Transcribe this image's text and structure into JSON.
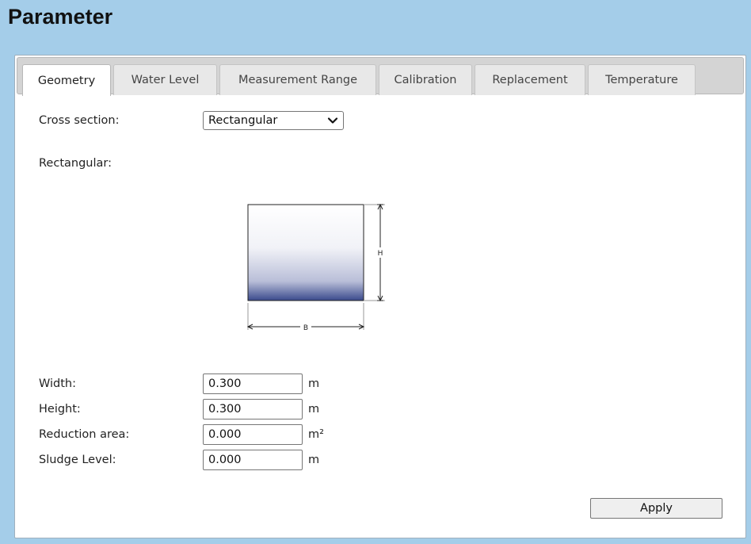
{
  "page": {
    "title": "Parameter"
  },
  "tabs": [
    {
      "label": "Geometry",
      "active": true
    },
    {
      "label": "Water Level",
      "active": false
    },
    {
      "label": "Measurement Range",
      "active": false
    },
    {
      "label": "Calibration",
      "active": false
    },
    {
      "label": "Replacement",
      "active": false
    },
    {
      "label": "Temperature",
      "active": false
    }
  ],
  "form": {
    "cross_section": {
      "label": "Cross section:",
      "value": "Rectangular"
    },
    "section_heading": "Rectangular:",
    "diagram": {
      "width_label": "B",
      "height_label": "H",
      "fill_color": "#3a4a8c"
    },
    "fields": [
      {
        "label": "Width:",
        "value": "0.300",
        "unit": "m"
      },
      {
        "label": "Height:",
        "value": "0.300",
        "unit": "m"
      },
      {
        "label": "Reduction area:",
        "value": "0.000",
        "unit": "m²"
      },
      {
        "label": "Sludge Level:",
        "value": "0.000",
        "unit": "m"
      }
    ],
    "apply_label": "Apply"
  }
}
